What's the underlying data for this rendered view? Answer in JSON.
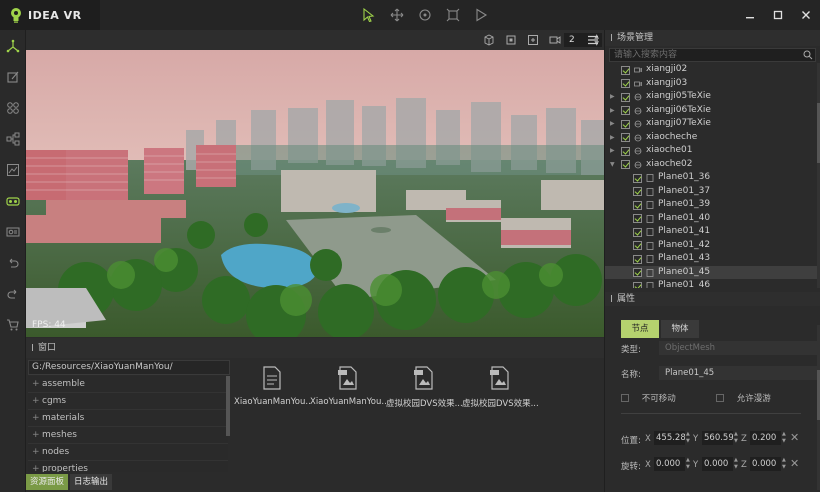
{
  "app": {
    "title": "IDEA VR"
  },
  "window_controls": [
    "minimize",
    "maximize",
    "close"
  ],
  "toolbar": {
    "tools": [
      "select-arrow-icon",
      "move-icon",
      "rotate-icon",
      "scale-icon",
      "play-icon"
    ]
  },
  "left_tools": [
    "axis-icon",
    "edit-icon",
    "modules-icon",
    "hierarchy-icon",
    "chart-icon",
    "vr-glasses-icon",
    "camera-card-icon",
    "undo-icon",
    "redo-icon",
    "cart-icon"
  ],
  "viewport": {
    "tools": [
      "cube-icon",
      "snap-icon",
      "frame-icon",
      "camera-icon"
    ],
    "camera_count": "2",
    "fps": "FPS: 44"
  },
  "window_panel": {
    "title": "窗口",
    "path": "G:/Resources/XiaoYuanManYou/",
    "folders": [
      "assemble",
      "cgms",
      "materials",
      "meshes",
      "nodes",
      "properties"
    ],
    "files": [
      {
        "name": "XiaoYuanManYou...",
        "icon": "text-file-icon"
      },
      {
        "name": "XiaoYuanManYou...",
        "icon": "image-file-icon"
      },
      {
        "name": "虚拟校园DVS效果...",
        "icon": "image-file-icon"
      },
      {
        "name": "虚拟校园DVS效果...",
        "icon": "image-file-icon"
      }
    ]
  },
  "bottom_tabs": [
    "资源面板",
    "日志输出"
  ],
  "scene": {
    "title": "场景管理",
    "search_placeholder": "请输入搜索内容",
    "items": [
      {
        "label": "xiangji02",
        "icon": "camera-icon"
      },
      {
        "label": "xiangji03",
        "icon": "camera-icon"
      },
      {
        "label": "xiangji05TeXie",
        "icon": "node-icon"
      },
      {
        "label": "xiangji06TeXie",
        "icon": "node-icon"
      },
      {
        "label": "xiangji07TeXie",
        "icon": "node-icon"
      },
      {
        "label": "xiaocheche",
        "icon": "node-icon"
      },
      {
        "label": "xiaoche01",
        "icon": "node-icon"
      },
      {
        "label": "xiaoche02",
        "icon": "node-icon"
      },
      {
        "label": "Plane01_36",
        "icon": "mesh-icon"
      },
      {
        "label": "Plane01_37",
        "icon": "mesh-icon"
      },
      {
        "label": "Plane01_39",
        "icon": "mesh-icon"
      },
      {
        "label": "Plane01_40",
        "icon": "mesh-icon"
      },
      {
        "label": "Plane01_41",
        "icon": "mesh-icon"
      },
      {
        "label": "Plane01_42",
        "icon": "mesh-icon"
      },
      {
        "label": "Plane01_43",
        "icon": "mesh-icon"
      },
      {
        "label": "Plane01_45",
        "icon": "mesh-icon"
      },
      {
        "label": "Plane01_46",
        "icon": "mesh-icon"
      }
    ]
  },
  "properties": {
    "title": "属性",
    "tabs": [
      "节点",
      "物体"
    ],
    "type_label": "类型:",
    "type_value": "ObjectMesh",
    "name_label": "名称:",
    "name_value": "Plane01_45",
    "immovable_label": "不可移动",
    "allow_walk_label": "允许漫游",
    "position_label": "位置:",
    "position": {
      "x": "455.283",
      "y": "560.592",
      "z": "0.200"
    },
    "rotation_label": "旋转:",
    "rotation": {
      "x": "0.000",
      "y": "0.000",
      "z": "0.000"
    }
  }
}
